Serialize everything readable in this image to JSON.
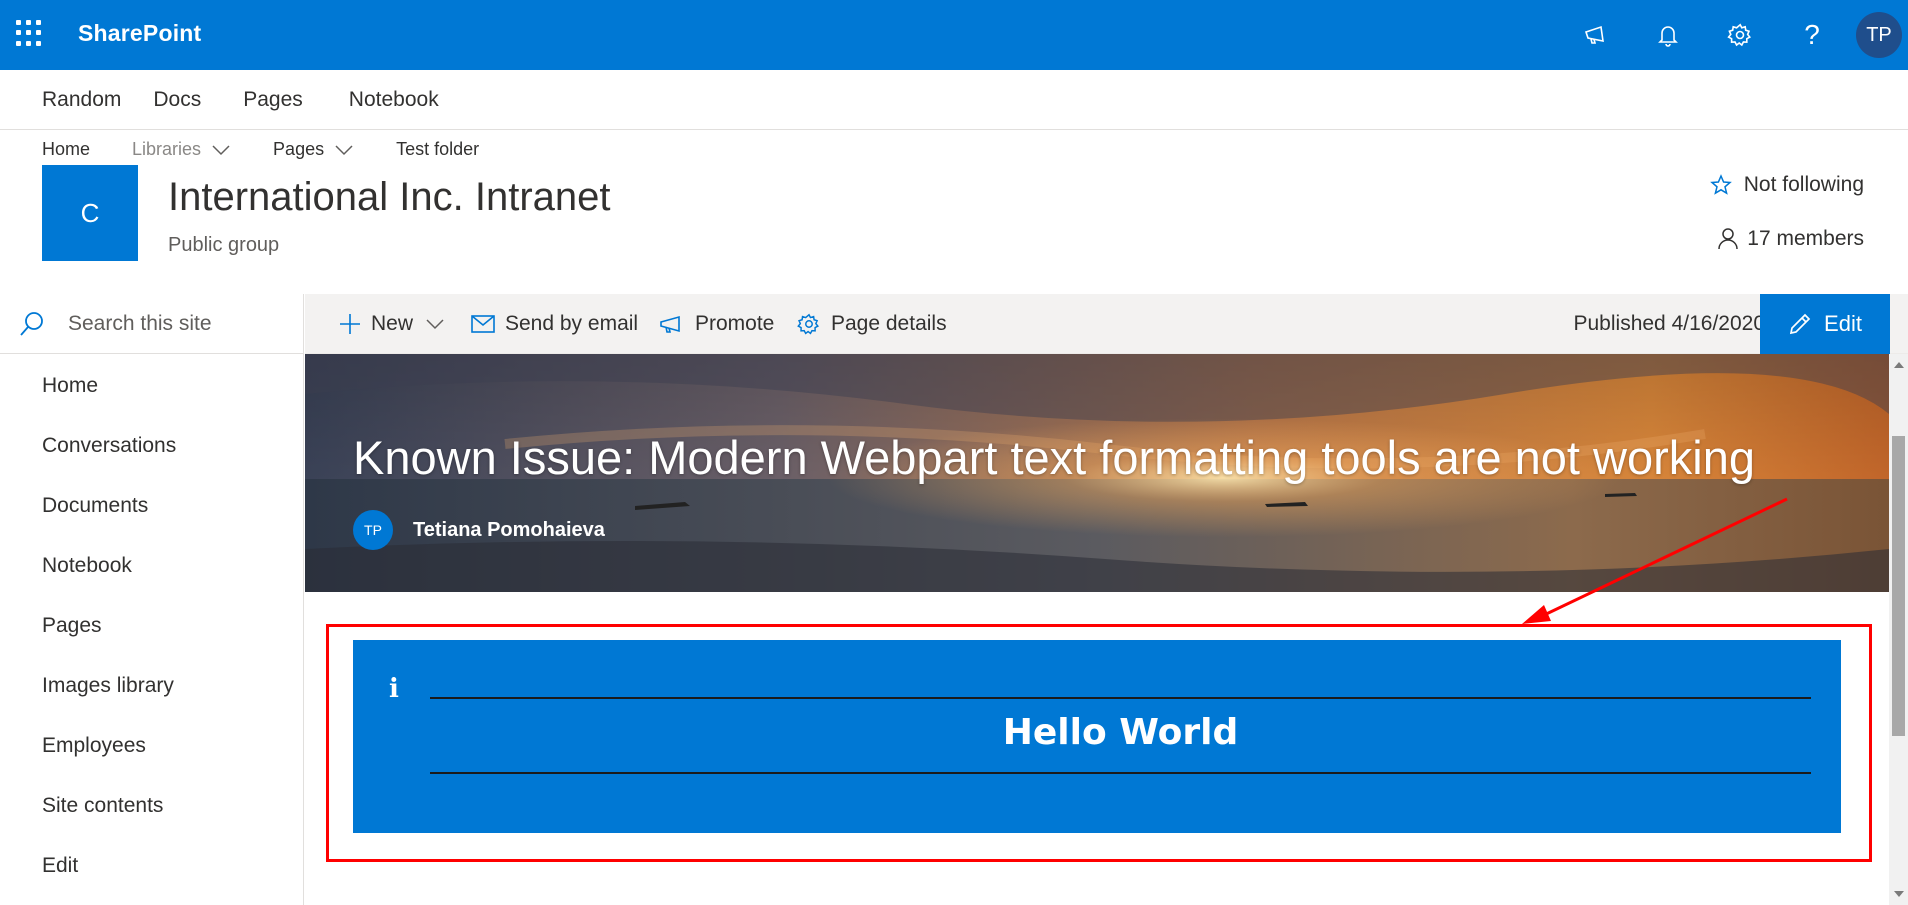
{
  "suite_bar": {
    "brand": "SharePoint",
    "avatar_initials": "TP",
    "icons": [
      "app-launcher-icon",
      "megaphone-icon",
      "bell-icon",
      "gear-icon",
      "help-icon"
    ],
    "help_glyph": "?",
    "color": "#0078d4"
  },
  "hub_nav": {
    "items": [
      "Random",
      "Docs",
      "Pages",
      "Notebook"
    ]
  },
  "site_header": {
    "top_nav": [
      "Home",
      "Libraries",
      "Pages",
      "Test folder"
    ],
    "logo_letter": "C",
    "title": "International Inc. Intranet",
    "subtitle": "Public group",
    "follow_label": "Not following",
    "members_label": "17 members"
  },
  "left_nav": {
    "search_placeholder": "Search this site",
    "items": [
      "Home",
      "Conversations",
      "Documents",
      "Notebook",
      "Pages",
      "Images library",
      "Employees",
      "Site contents",
      "Edit"
    ]
  },
  "command_bar": {
    "new_label": "New",
    "send_email_label": "Send by email",
    "promote_label": "Promote",
    "page_details_label": "Page details",
    "published_label": "Published 4/16/2020",
    "edit_label": "Edit"
  },
  "hero": {
    "title": "Known Issue: Modern Webpart text formatting tools are not working",
    "author_initials": "TP",
    "author_name": "Tetiana Pomohaieva"
  },
  "callout": {
    "icon_glyph": "i",
    "text": "Hello World",
    "background": "#0078d4"
  },
  "annotation": {
    "highlight_color": "#ff0000"
  }
}
